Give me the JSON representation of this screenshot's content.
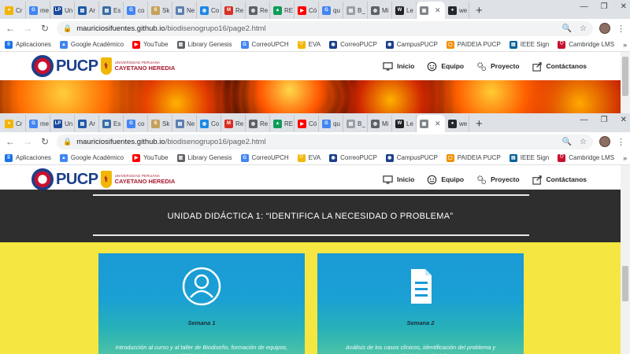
{
  "browser": {
    "tabs": [
      {
        "label": "Cr",
        "icon": "chrome-icon",
        "color": "#f4b400"
      },
      {
        "label": "me",
        "icon": "google-icon",
        "color": "#4285f4"
      },
      {
        "label": "Un",
        "icon": "lp-icon",
        "color": "#1a4b9c"
      },
      {
        "label": "Ar",
        "icon": "doc-icon",
        "color": "#1f5aa6"
      },
      {
        "label": "Es",
        "icon": "doc-icon",
        "color": "#3a6ea5"
      },
      {
        "label": "co",
        "icon": "google-icon",
        "color": "#4285f4"
      },
      {
        "label": "Sk",
        "icon": "sketch-icon",
        "color": "#c6a15b"
      },
      {
        "label": "Ne",
        "icon": "doc-icon",
        "color": "#5a7fb0"
      },
      {
        "label": "Co",
        "icon": "globe-icon",
        "color": "#1e88e5"
      },
      {
        "label": "Re",
        "icon": "gmail-icon",
        "color": "#d93025"
      },
      {
        "label": "Re",
        "icon": "globe-icon",
        "color": "#5f6368"
      },
      {
        "label": "RE",
        "icon": "drive-icon",
        "color": "#0f9d58"
      },
      {
        "label": "Có",
        "icon": "youtube-icon",
        "color": "#ff0000"
      },
      {
        "label": "qu",
        "icon": "google-icon",
        "color": "#4285f4"
      },
      {
        "label": "B_",
        "icon": "doc-icon",
        "color": "#9aa0a6"
      },
      {
        "label": "Mi",
        "icon": "globe-icon",
        "color": "#5f6368"
      },
      {
        "label": "Le",
        "icon": "wikipedia-icon",
        "color": "#202124"
      },
      {
        "label": "",
        "icon": "image-icon",
        "color": "#80868b",
        "active": true
      },
      {
        "label": "we",
        "icon": "github-icon",
        "color": "#24292e"
      }
    ],
    "url_host": "mauriciosifuentes.github.io",
    "url_path": "/biodisenogrupo16/page2.html",
    "bookmarks": [
      {
        "label": "Aplicaciones",
        "icon": "apps-icon",
        "color": "#1a73e8"
      },
      {
        "label": "Google Académico",
        "icon": "scholar-icon",
        "color": "#4285f4"
      },
      {
        "label": "YouTube",
        "icon": "youtube-icon",
        "color": "#ff0000"
      },
      {
        "label": "Library Genesis",
        "icon": "book-icon",
        "color": "#5f6368"
      },
      {
        "label": "CorreoUPCH",
        "icon": "google-icon",
        "color": "#4285f4"
      },
      {
        "label": "EVA",
        "icon": "shield-icon",
        "color": "#f2b705"
      },
      {
        "label": "CorreoPUCP",
        "icon": "seal-icon",
        "color": "#1b3f8b"
      },
      {
        "label": "CampusPUCP",
        "icon": "seal-icon",
        "color": "#1b3f8b"
      },
      {
        "label": "PAIDEIA PUCP",
        "icon": "paideia-icon",
        "color": "#f29100"
      },
      {
        "label": "IEEE Sign",
        "icon": "ieee-icon",
        "color": "#00629b"
      },
      {
        "label": "Cambridge LMS",
        "icon": "cambridge-icon",
        "color": "#c8102e"
      }
    ],
    "bookmarks_more": "»"
  },
  "site": {
    "logo": {
      "pucp": "PUCP",
      "uph_small": "UNIVERSIDAD PERUANA",
      "uph_big": "CAYETANO HEREDIA"
    },
    "nav": [
      {
        "label": "Inicio",
        "icon": "monitor-icon"
      },
      {
        "label": "Equipo",
        "icon": "smiley-icon"
      },
      {
        "label": "Proyecto",
        "icon": "gears-icon"
      },
      {
        "label": "Contáctanos",
        "icon": "share-icon"
      }
    ]
  },
  "content": {
    "unit_title": "UNIDAD DIDÁCTICA 1: “IDENTIFICA LA NECESIDAD O PROBLEMA”",
    "cards": [
      {
        "week": "Semana 1",
        "icon": "user-icon",
        "desc": "Introducción al curso y al taller de Biodiseño, formación de equipos, análisis de los casos."
      },
      {
        "week": "Semana 2",
        "icon": "document-icon",
        "desc": "Análisis de los casos clínicos, identificación del problema y desarrollo del estado del arte."
      }
    ]
  }
}
